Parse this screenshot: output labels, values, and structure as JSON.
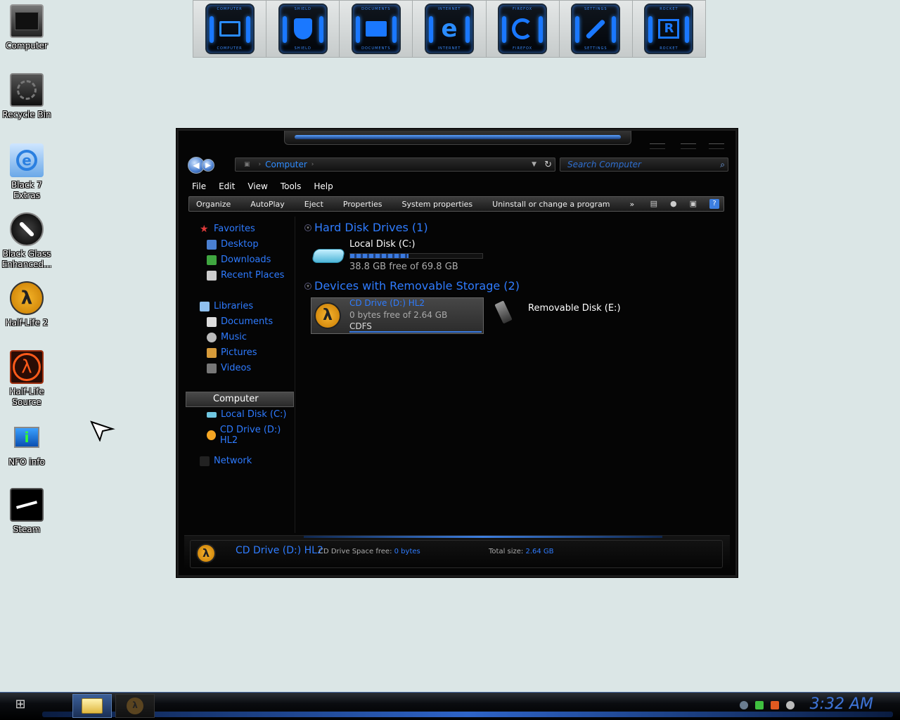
{
  "desktop": {
    "icons": [
      {
        "label": "Computer",
        "icon": "computer-icon"
      },
      {
        "label": "Recycle Bin",
        "icon": "recycle-bin-icon"
      },
      {
        "label": "Black 7\nExtras",
        "icon": "internet-explorer-icon"
      },
      {
        "label": "Black Glass\nEnhanced...",
        "icon": "black-glass-icon"
      },
      {
        "label": "Half-Life 2",
        "icon": "half-life-2-icon"
      },
      {
        "label": "Half-Life\nSource",
        "icon": "half-life-source-icon"
      },
      {
        "label": "NFO info",
        "icon": "nfo-info-icon"
      },
      {
        "label": "Steam",
        "icon": "steam-icon"
      }
    ]
  },
  "dock": {
    "items": [
      {
        "caption": "COMPUTER",
        "icon": "monitor-icon"
      },
      {
        "caption": "SHIELD",
        "icon": "shield-icon"
      },
      {
        "caption": "DOCUMENTS",
        "icon": "folder-icon"
      },
      {
        "caption": "INTERNET",
        "icon": "internet-explorer-icon"
      },
      {
        "caption": "FIREFOX",
        "icon": "firefox-icon"
      },
      {
        "caption": "SETTINGS",
        "icon": "wrench-icon"
      },
      {
        "caption": "ROCKET",
        "icon": "rocket-dock-icon"
      }
    ]
  },
  "explorer": {
    "address": {
      "location": "Computer"
    },
    "search": {
      "placeholder": "Search Computer"
    },
    "menu": [
      "File",
      "Edit",
      "View",
      "Tools",
      "Help"
    ],
    "commands": [
      "Organize",
      "AutoPlay",
      "Eject",
      "Properties",
      "System properties",
      "Uninstall or change a program",
      "»"
    ],
    "nav": {
      "favorites": {
        "label": "Favorites",
        "items": [
          "Desktop",
          "Downloads",
          "Recent Places"
        ]
      },
      "libraries": {
        "label": "Libraries",
        "items": [
          "Documents",
          "Music",
          "Pictures",
          "Videos"
        ]
      },
      "computer": {
        "label": "Computer",
        "items": [
          "Local Disk (C:)",
          "CD Drive (D:) HL2"
        ]
      },
      "network": {
        "label": "Network"
      }
    },
    "groups": {
      "hdd": {
        "title": "Hard Disk Drives (1)"
      },
      "removable": {
        "title": "Devices with Removable Storage (2)"
      }
    },
    "drives": {
      "c": {
        "name": "Local Disk (C:)",
        "free": "38.8 GB free of 69.8 GB",
        "used_fraction": 0.44
      },
      "d": {
        "name": "CD Drive (D:) HL2",
        "free": "0 bytes free of 2.64 GB",
        "fs": "CDFS"
      },
      "e": {
        "name": "Removable Disk (E:)"
      }
    },
    "details": {
      "name": "CD Drive (D:) HL2",
      "space_label": "CD Drive Space free:",
      "space_value": "0 bytes",
      "total_label": "Total size:",
      "total_value": "2.64 GB"
    }
  },
  "taskbar": {
    "clock": "3:32 AM"
  },
  "colors": {
    "accent": "#2f7cff",
    "desktop_bg": "#dbe6e6",
    "window_bg": "#050505"
  }
}
